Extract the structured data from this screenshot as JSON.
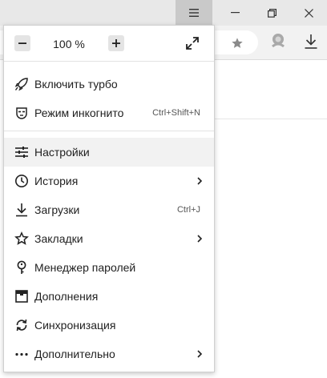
{
  "zoom": {
    "decrease_icon": "minus-icon",
    "value": "100 %",
    "increase_icon": "plus-icon",
    "fullscreen_icon": "fullscreen-icon"
  },
  "menu": {
    "items": [
      {
        "label": "Включить турбо",
        "icon": "rocket-icon",
        "shortcut": ""
      },
      {
        "label": "Режим инкогнито",
        "icon": "incognito-mask-icon",
        "shortcut": "Ctrl+Shift+N"
      },
      {
        "label": "Настройки",
        "icon": "settings-sliders-icon",
        "shortcut": ""
      },
      {
        "label": "История",
        "icon": "clock-icon",
        "shortcut": ""
      },
      {
        "label": "Загрузки",
        "icon": "download-icon",
        "shortcut": "Ctrl+J"
      },
      {
        "label": "Закладки",
        "icon": "star-outline-icon",
        "shortcut": ""
      },
      {
        "label": "Менеджер паролей",
        "icon": "key-icon",
        "shortcut": ""
      },
      {
        "label": "Дополнения",
        "icon": "addons-box-icon",
        "shortcut": ""
      },
      {
        "label": "Синхронизация",
        "icon": "sync-icon",
        "shortcut": ""
      },
      {
        "label": "Дополнительно",
        "icon": "more-dots-icon",
        "shortcut": ""
      }
    ]
  },
  "colors": {
    "menu_background": "#ffffff",
    "hover_background": "#f2f2f2",
    "titlebar": "#e8e8e8",
    "active_menu_button": "#c9c9c9"
  }
}
